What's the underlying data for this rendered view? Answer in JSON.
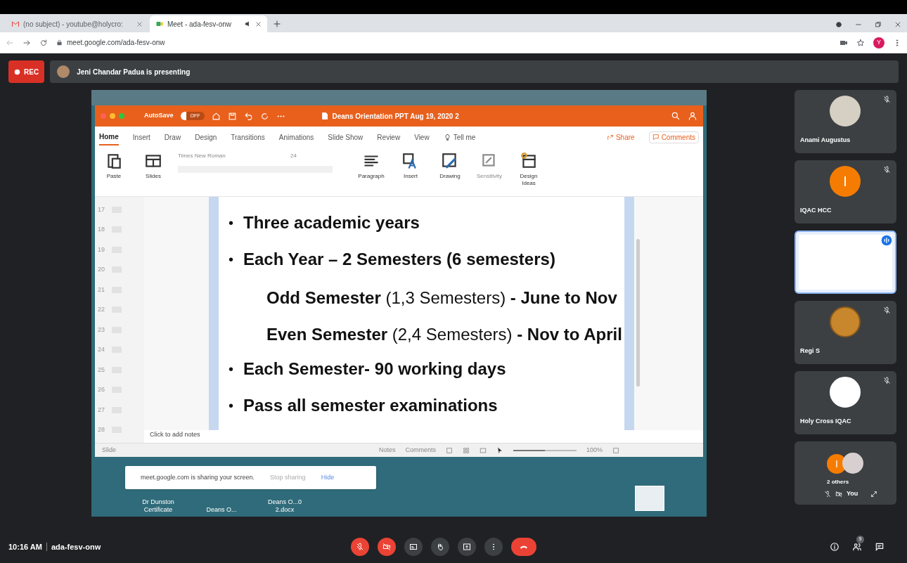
{
  "browser": {
    "tabs": [
      {
        "kind": "mail",
        "title": "(no subject) - youtube@holycro:",
        "selected": false
      },
      {
        "kind": "meet",
        "title": "Meet - ada-fesv-onw",
        "selected": true,
        "audio": true
      }
    ],
    "url": "meet.google.com/ada-fesv-onw",
    "profile_initial": "Y"
  },
  "meet": {
    "rec": "REC",
    "presenter": "Jeni Chandar Padua is presenting"
  },
  "powerpoint": {
    "autosave": "AutoSave",
    "toggle": "OFF",
    "title": "Deans Orientation PPT Aug 19, 2020 2",
    "tabs": [
      {
        "label": "Home",
        "selected": true
      },
      {
        "label": "Insert",
        "selected": false
      },
      {
        "label": "Draw",
        "selected": false
      },
      {
        "label": "Design",
        "selected": false
      },
      {
        "label": "Transitions",
        "selected": false
      },
      {
        "label": "Animations",
        "selected": false
      },
      {
        "label": "Slide Show",
        "selected": false
      },
      {
        "label": "Review",
        "selected": false
      },
      {
        "label": "View",
        "selected": false
      }
    ],
    "tell_me": "Tell me",
    "share": "Share",
    "comments": "Comments",
    "font": "Times New Roman",
    "font_size": "24",
    "groups": [
      {
        "kind": "paste",
        "label": "Paste",
        "disabled": false
      },
      {
        "kind": "slides",
        "label": "Slides",
        "disabled": false
      },
      {
        "kind": "paragraph",
        "label": "Paragraph",
        "disabled": false
      },
      {
        "kind": "insert",
        "label": "Insert",
        "disabled": false
      },
      {
        "kind": "drawing",
        "label": "Drawing",
        "disabled": false
      },
      {
        "kind": "sensitivity",
        "label": "Sensitivity",
        "disabled": true
      },
      {
        "kind": "ideas",
        "label": "Design Ideas",
        "disabled": false
      }
    ],
    "slide_numbers": [
      "17",
      "18",
      "19",
      "20",
      "21",
      "22",
      "23",
      "24",
      "25",
      "26",
      "27",
      "28"
    ],
    "slide": [
      {
        "kind": "bullet",
        "marker": "•",
        "text": "Three academic years"
      },
      {
        "kind": "bullet",
        "marker": "•",
        "text": "Each Year – 2 Semesters (6 semesters)"
      },
      {
        "kind": "sub",
        "text": "**Odd Semester** (1,3 Semesters) **- June to Nov**"
      },
      {
        "kind": "sub",
        "text": "**Even Semester** (2,4 Semesters) **- Nov to April**"
      },
      {
        "kind": "bullet",
        "marker": "•",
        "text": "Each Semester- 90 working days"
      },
      {
        "kind": "bullet",
        "marker": "•",
        "text": "Pass all semester examinations"
      }
    ],
    "notes": "Click to add notes",
    "status": {
      "slide": "Slide",
      "notes": "Notes",
      "comments": "Comments",
      "zoom": "100%",
      "zoom_slider": {
        "level": 0.5
      }
    }
  },
  "share_notice": {
    "text": "meet.google.com is sharing your screen.",
    "stop": "Stop sharing",
    "hide": "Hide"
  },
  "desktop_icons": [
    {
      "label": "Dr Dunston Certificate"
    },
    {
      "label": "Deans O..."
    },
    {
      "label": "Deans O...0 2.docx"
    }
  ],
  "participants": [
    {
      "name": "Anami Augustus",
      "kind": "photo",
      "muted": true,
      "selected": false
    },
    {
      "name": "IQAC HCC",
      "kind": "initial",
      "initial": "I",
      "muted": true,
      "selected": false
    },
    {
      "kind": "screen",
      "selected": true
    },
    {
      "name": "Regi S",
      "kind": "badge",
      "muted": true,
      "selected": false
    },
    {
      "name": "Holy Cross IQAC",
      "kind": "crest",
      "muted": true,
      "selected": false
    }
  ],
  "others": {
    "initial": "I",
    "label": "2 others"
  },
  "self": {
    "label": "You"
  },
  "bottom": {
    "time": "10:16 AM",
    "code": "ada-fesv-onw",
    "people_count": "9"
  }
}
